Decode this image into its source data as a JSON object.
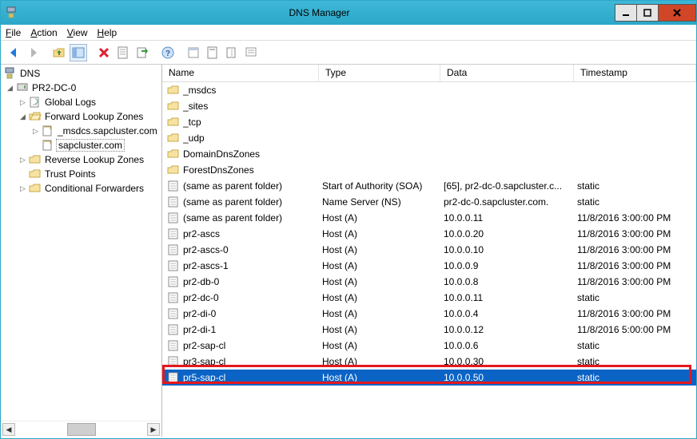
{
  "window": {
    "title": "DNS Manager"
  },
  "menu": [
    "File",
    "Action",
    "View",
    "Help"
  ],
  "tree": {
    "root": "DNS",
    "server": "PR2-DC-0",
    "children": [
      "Global Logs",
      "Forward Lookup Zones",
      "Reverse Lookup Zones",
      "Trust Points",
      "Conditional Forwarders"
    ],
    "fwd_children": [
      "_msdcs.sapcluster.com",
      "sapcluster.com"
    ]
  },
  "columns": {
    "name": "Name",
    "type": "Type",
    "data": "Data",
    "ts": "Timestamp"
  },
  "folders": [
    "_msdcs",
    "_sites",
    "_tcp",
    "_udp",
    "DomainDnsZones",
    "ForestDnsZones"
  ],
  "records": [
    {
      "name": "(same as parent folder)",
      "type": "Start of Authority (SOA)",
      "data": "[65], pr2-dc-0.sapcluster.c...",
      "ts": "static"
    },
    {
      "name": "(same as parent folder)",
      "type": "Name Server (NS)",
      "data": "pr2-dc-0.sapcluster.com.",
      "ts": "static"
    },
    {
      "name": "(same as parent folder)",
      "type": "Host (A)",
      "data": "10.0.0.11",
      "ts": "11/8/2016 3:00:00 PM"
    },
    {
      "name": "pr2-ascs",
      "type": "Host (A)",
      "data": "10.0.0.20",
      "ts": "11/8/2016 3:00:00 PM"
    },
    {
      "name": "pr2-ascs-0",
      "type": "Host (A)",
      "data": "10.0.0.10",
      "ts": "11/8/2016 3:00:00 PM"
    },
    {
      "name": "pr2-ascs-1",
      "type": "Host (A)",
      "data": "10.0.0.9",
      "ts": "11/8/2016 3:00:00 PM"
    },
    {
      "name": "pr2-db-0",
      "type": "Host (A)",
      "data": "10.0.0.8",
      "ts": "11/8/2016 3:00:00 PM"
    },
    {
      "name": "pr2-dc-0",
      "type": "Host (A)",
      "data": "10.0.0.11",
      "ts": "static"
    },
    {
      "name": "pr2-di-0",
      "type": "Host (A)",
      "data": "10.0.0.4",
      "ts": "11/8/2016 3:00:00 PM"
    },
    {
      "name": "pr2-di-1",
      "type": "Host (A)",
      "data": "10.0.0.12",
      "ts": "11/8/2016 5:00:00 PM"
    },
    {
      "name": "pr2-sap-cl",
      "type": "Host (A)",
      "data": "10.0.0.6",
      "ts": "static"
    },
    {
      "name": "pr3-sap-cl",
      "type": "Host (A)",
      "data": "10.0.0.30",
      "ts": "static"
    },
    {
      "name": "pr5-sap-cl",
      "type": "Host (A)",
      "data": "10.0.0.50",
      "ts": "static",
      "selected": true
    }
  ]
}
